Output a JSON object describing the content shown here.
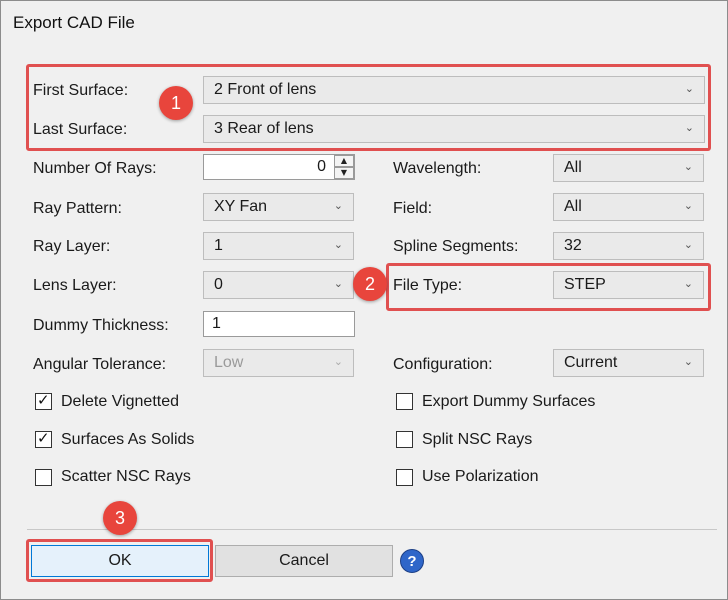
{
  "window": {
    "title": "Export CAD File"
  },
  "fields": {
    "first_surface": {
      "label": "First Surface:",
      "value": "2 Front of lens"
    },
    "last_surface": {
      "label": "Last Surface:",
      "value": "3 Rear of lens"
    },
    "number_of_rays": {
      "label": "Number Of Rays:",
      "value": "0"
    },
    "ray_pattern": {
      "label": "Ray Pattern:",
      "value": "XY Fan"
    },
    "ray_layer": {
      "label": "Ray Layer:",
      "value": "1"
    },
    "lens_layer": {
      "label": "Lens Layer:",
      "value": "0"
    },
    "dummy_thickness": {
      "label": "Dummy Thickness:",
      "value": "1"
    },
    "angular_tolerance": {
      "label": "Angular Tolerance:",
      "value": "Low"
    },
    "wavelength": {
      "label": "Wavelength:",
      "value": "All"
    },
    "field": {
      "label": "Field:",
      "value": "All"
    },
    "spline_segments": {
      "label": "Spline Segments:",
      "value": "32"
    },
    "file_type": {
      "label": "File Type:",
      "value": "STEP"
    },
    "configuration": {
      "label": "Configuration:",
      "value": "Current"
    }
  },
  "checkboxes": {
    "delete_vignetted": {
      "label": "Delete Vignetted",
      "checked": true
    },
    "surfaces_as_solids": {
      "label": "Surfaces As Solids",
      "checked": true
    },
    "scatter_nsc_rays": {
      "label": "Scatter NSC Rays",
      "checked": false
    },
    "export_dummy_surfaces": {
      "label": "Export Dummy Surfaces",
      "checked": false
    },
    "split_nsc_rays": {
      "label": "Split NSC Rays",
      "checked": false
    },
    "use_polarization": {
      "label": "Use Polarization",
      "checked": false
    }
  },
  "buttons": {
    "ok": "OK",
    "cancel": "Cancel",
    "help": "?"
  },
  "annotations": {
    "badge1": "1",
    "badge2": "2",
    "badge3": "3"
  },
  "icons": {
    "chevron": "⌄",
    "check": "✓",
    "spin_up": "▲",
    "spin_down": "▼"
  },
  "colors": {
    "highlight": "#e05050",
    "badge": "#e8453c",
    "help": "#2f66c9"
  }
}
